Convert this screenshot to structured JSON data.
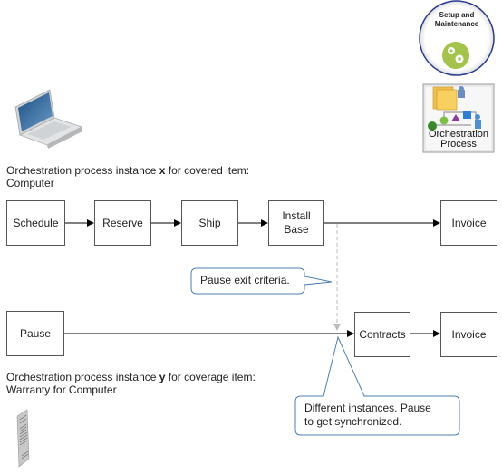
{
  "icons": {
    "setup": {
      "label_line1": "Setup and",
      "label_line2": "Maintenance",
      "accent": "#a3c34a",
      "ring": "#2a3a8c"
    },
    "orchestration": {
      "label_line1": "Orchestration",
      "label_line2": "Process"
    }
  },
  "instance_x": {
    "caption_prefix": "Orchestration process instance ",
    "caption_var": "x",
    "caption_suffix": " for covered item:",
    "caption_line2": "Computer",
    "steps": [
      "Schedule",
      "Reserve",
      "Ship",
      "Install Base",
      "Invoice"
    ]
  },
  "instance_y": {
    "caption_prefix": "Orchestration process instance ",
    "caption_var": "y",
    "caption_suffix": " for coverage  item:",
    "caption_line2": "Warranty for Computer",
    "steps": [
      "Pause",
      "Contracts",
      "Invoice"
    ]
  },
  "callouts": {
    "pause_exit": "Pause exit criteria.",
    "sync_line1": "Different  instances. Pause",
    "sync_line2": "to get synchronized."
  },
  "colors": {
    "callout_border": "#4f7fae",
    "box_border": "#555555",
    "dashed": "#bbbbbb"
  }
}
